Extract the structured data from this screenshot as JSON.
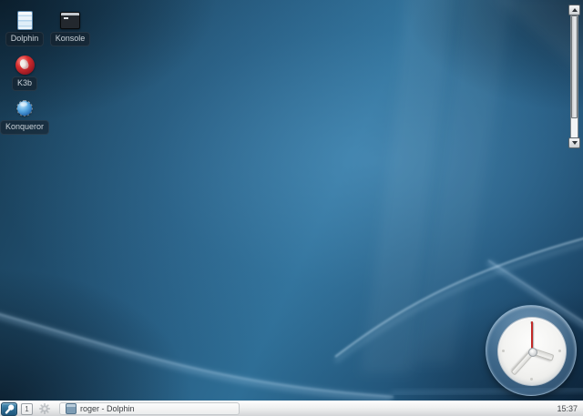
{
  "desktop": {
    "icons": [
      {
        "id": "dolphin",
        "label": "Dolphin"
      },
      {
        "id": "konsole",
        "label": "Konsole"
      },
      {
        "id": "k3b",
        "label": "K3b"
      },
      {
        "id": "konqueror",
        "label": "Konqueror"
      }
    ],
    "analog_clock": {
      "time": "15:37"
    }
  },
  "taskbar": {
    "pager_label": "1",
    "tasks": [
      {
        "label": "roger - Dolphin"
      }
    ],
    "clock_label": "15:37"
  },
  "icon_glyphs": {
    "launcher": "magnifier-icon",
    "panel_settings": "gear-icon",
    "scroll_up": "up-arrow-icon",
    "scroll_down": "down-arrow-icon",
    "task": "window-icon"
  },
  "colors": {
    "wallpaper_mid": "#2e6e96",
    "wallpaper_dark": "#0b1d2d",
    "taskbar_bg": "#e9ebec",
    "launcher_blue": "#2f6e94",
    "second_hand": "#c22a28",
    "icon_label_bg": "rgba(22,32,42,0.6)",
    "icon_label_text": "#c9d2d9"
  }
}
